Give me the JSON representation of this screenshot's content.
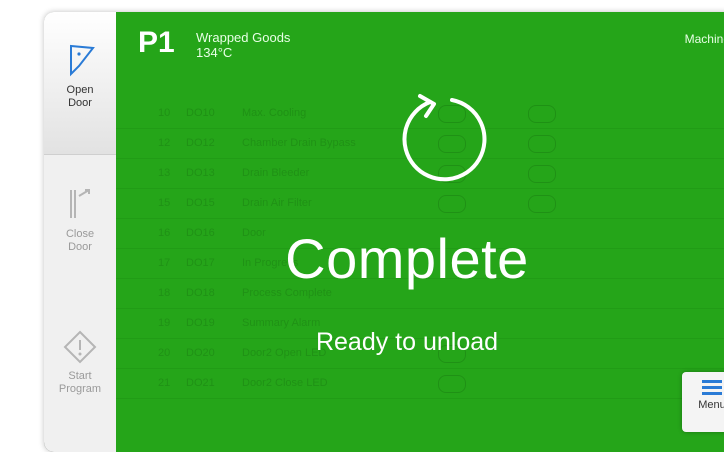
{
  "sidebar": {
    "items": [
      {
        "label_line1": "Open",
        "label_line2": "Door",
        "icon": "open-door-icon"
      },
      {
        "label_line1": "Close",
        "label_line2": "Door",
        "icon": "close-door-icon"
      },
      {
        "label_line1": "Start",
        "label_line2": "Program",
        "icon": "start-program-icon"
      }
    ]
  },
  "header": {
    "chamber": "P1",
    "program_name": "Wrapped Goods",
    "temperature": "134°C",
    "machine_label": "Machine"
  },
  "status": {
    "icon": "cycle-complete-icon",
    "title": "Complete",
    "subtitle": "Ready to unload"
  },
  "menu_button": {
    "label": "Menu",
    "icon": "menu-icon"
  },
  "background_table": {
    "rows": [
      {
        "num": "10",
        "tag": "DO10",
        "name": "Max. Cooling"
      },
      {
        "num": "12",
        "tag": "DO12",
        "name": "Chamber Drain Bypass"
      },
      {
        "num": "13",
        "tag": "DO13",
        "name": "Drain Bleeder"
      },
      {
        "num": "15",
        "tag": "DO15",
        "name": "Drain Air Filter"
      },
      {
        "num": "16",
        "tag": "DO16",
        "name": "Door"
      },
      {
        "num": "17",
        "tag": "DO17",
        "name": "In Progress"
      },
      {
        "num": "18",
        "tag": "DO18",
        "name": "Process Complete"
      },
      {
        "num": "19",
        "tag": "DO19",
        "name": "Summary Alarm"
      },
      {
        "num": "20",
        "tag": "DO20",
        "name": "Door2 Open LED"
      },
      {
        "num": "21",
        "tag": "DO21",
        "name": "Door2 Close LED"
      }
    ]
  },
  "colors": {
    "accent_green": "#25a519",
    "menu_blue": "#2a7bd6"
  }
}
